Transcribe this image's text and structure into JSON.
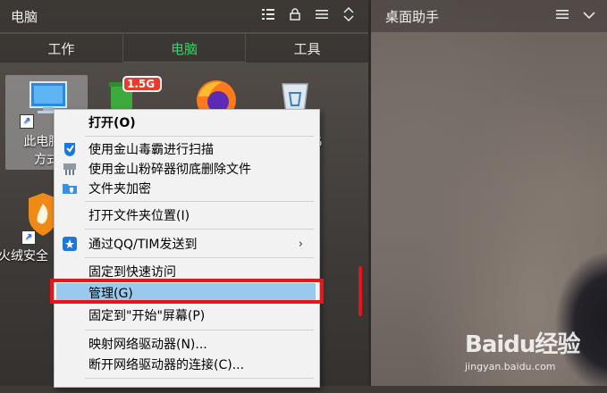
{
  "left_fence": {
    "title": "电脑",
    "tools": [
      "list-icon",
      "lock-icon",
      "menu-icon",
      "resize-icon"
    ],
    "tabs": [
      {
        "label": "工作",
        "active": false
      },
      {
        "label": "电脑",
        "active": true
      },
      {
        "label": "工具",
        "active": false
      }
    ]
  },
  "desktop_icons": [
    {
      "label_line1": "此电脑 -",
      "label_line2": "方式",
      "icon": "computer-icon",
      "selected": true
    },
    {
      "label": "1.5G",
      "icon": "green-trash-icon"
    },
    {
      "label": "",
      "icon": "firefox-icon"
    },
    {
      "label": "",
      "icon": "recycle-bin-icon"
    },
    {
      "label": "火绒安全",
      "icon": "huorong-icon"
    }
  ],
  "right_fence": {
    "title": "桌面助手",
    "tools": [
      "menu-icon",
      "chevron-down-icon"
    ]
  },
  "context_menu": {
    "items": [
      {
        "label": "打开(O)",
        "bold": true,
        "icon": ""
      },
      {
        "label": "使用金山毒霸进行扫描",
        "icon": "kingsoft-scan-icon"
      },
      {
        "label": "使用金山粉碎器彻底删除文件",
        "icon": "shredder-icon"
      },
      {
        "label": "文件夹加密",
        "icon": "folder-lock-icon"
      },
      {
        "label": "打开文件夹位置(I)",
        "icon": ""
      },
      {
        "label": "通过QQ/TIM发送到",
        "icon": "qq-icon",
        "submenu": true
      },
      {
        "label": "固定到快速访问",
        "icon": ""
      },
      {
        "label": "管理(G)",
        "icon": "",
        "highlighted": true
      },
      {
        "label": "固定到\"开始\"屏幕(P)",
        "icon": ""
      },
      {
        "label": "映射网络驱动器(N)...",
        "icon": ""
      },
      {
        "label": "断开网络驱动器的连接(C)...",
        "icon": ""
      }
    ],
    "submenu_arrow": "›"
  },
  "partial_label": "5",
  "watermark": {
    "logo": "Baidu经验",
    "url": "jingyan.baidu.com"
  },
  "colors": {
    "accent_tab": "#38d26b",
    "highlight": "#99c9ef",
    "annotation_red": "#e2161b"
  }
}
